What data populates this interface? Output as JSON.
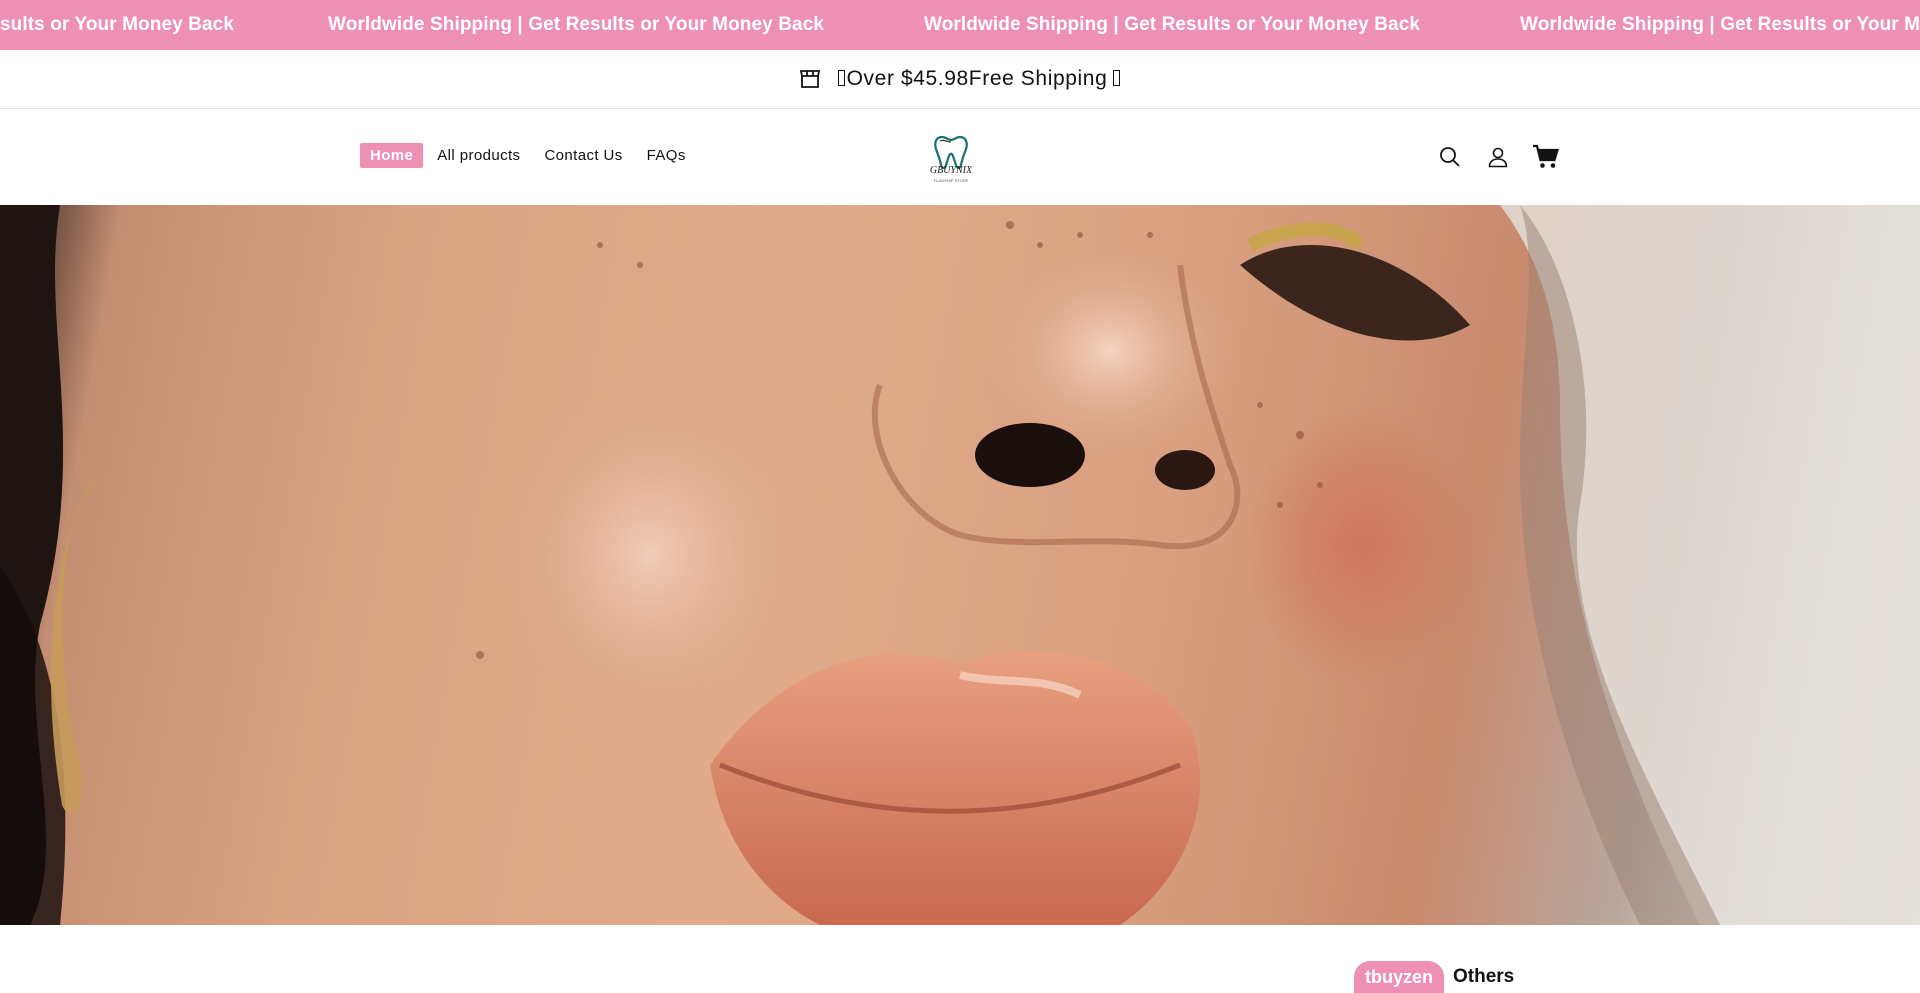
{
  "marquee": {
    "items": [
      "Worldwide Shipping | Get Results or Your Money Back",
      "Worldwide Shipping | Get Results or Your Money Back",
      "Worldwide Shipping | Get Results or Your Money Back",
      "Worldwide Shipping | Get Results or Your Money Back"
    ],
    "first_item_visible": "sults or Your Money Back",
    "last_item_visible": "Worldwide Shipping | Get Results or Your M"
  },
  "announcement": {
    "text": "Over $45.98Free Shipping",
    "icon": "store-icon"
  },
  "nav": {
    "items": [
      {
        "label": "Home",
        "active": true
      },
      {
        "label": "All products",
        "active": false
      },
      {
        "label": "Contact Us",
        "active": false
      },
      {
        "label": "FAQs",
        "active": false
      }
    ]
  },
  "logo": {
    "brand": "GBUYNIX",
    "tagline": "FLAGSHIP STORE"
  },
  "header_icons": [
    "search-icon",
    "account-icon",
    "cart-icon"
  ],
  "hero": {
    "image": "close-up face portrait with glossy lips and freckles"
  },
  "bottom": {
    "chip_label": "tbuyzen",
    "others_label": "Others"
  },
  "colors": {
    "accent": "#ee8fb4",
    "text": "#121212",
    "background": "#ffffff"
  }
}
